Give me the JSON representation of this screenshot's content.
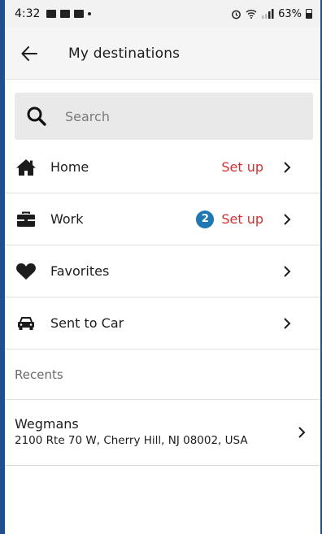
{
  "status_bar": {
    "time": "4:32",
    "battery": "63%",
    "left_icons": [
      "gallery-icon",
      "radio-icon",
      "ring-icon",
      "dot-icon"
    ],
    "right_icons": [
      "alarm-icon",
      "wifi-icon",
      "lte-signal-icon",
      "battery-icon"
    ]
  },
  "header": {
    "title": "My destinations",
    "back_icon": "arrow-left-icon"
  },
  "search": {
    "placeholder": "Search",
    "value": ""
  },
  "destinations": [
    {
      "label": "Home",
      "icon": "home-icon",
      "action": "Set up",
      "badge": null
    },
    {
      "label": "Work",
      "icon": "briefcase-icon",
      "action": "Set up",
      "badge": "2"
    },
    {
      "label": "Favorites",
      "icon": "heart-icon",
      "action": null,
      "badge": null
    },
    {
      "label": "Sent to Car",
      "icon": "car-icon",
      "action": null,
      "badge": null
    }
  ],
  "recents": {
    "header": "Recents",
    "items": [
      {
        "title": "Wegmans",
        "address": "2100 Rte 70 W, Cherry Hill, NJ 08002, USA"
      }
    ]
  },
  "colors": {
    "accent_red": "#d32f2f",
    "badge_blue": "#1f78b4",
    "frame_blue": "#1f4f8f",
    "search_bg": "#e9e9e9"
  }
}
